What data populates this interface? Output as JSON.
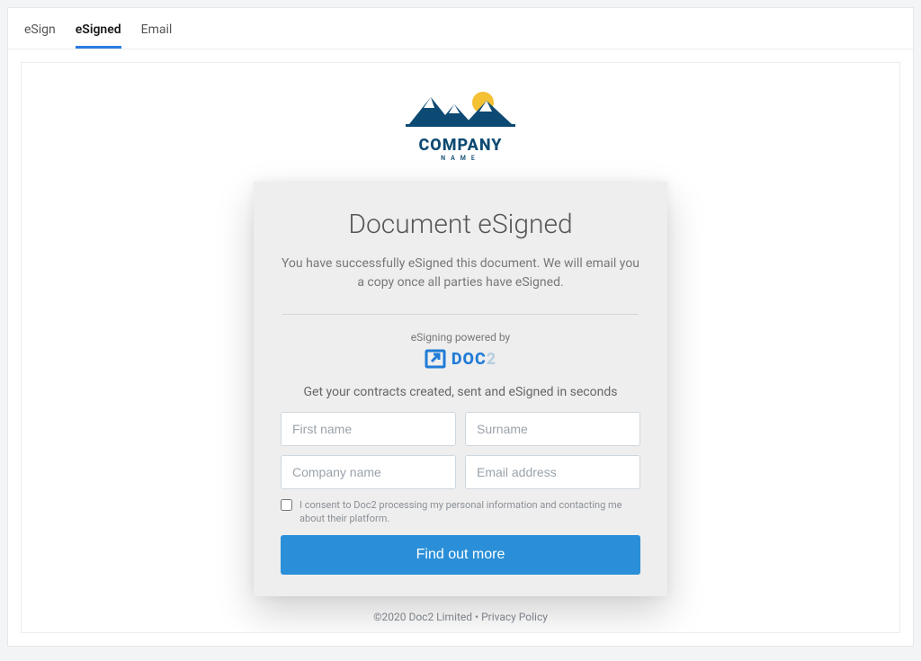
{
  "tabs": [
    {
      "label": "eSign",
      "active": false
    },
    {
      "label": "eSigned",
      "active": true
    },
    {
      "label": "Email",
      "active": false
    }
  ],
  "company_logo": {
    "name": "COMPANY",
    "subline": "NAME"
  },
  "card": {
    "title": "Document eSigned",
    "body": "You have successfully eSigned this document. We will email you a copy once all parties have eSigned.",
    "powered_by_label": "eSigning powered by",
    "provider_brand_part1": "DOC",
    "provider_brand_part2": "2",
    "cta_line": "Get your contracts created, sent and eSigned in seconds",
    "fields": {
      "first_name_placeholder": "First name",
      "surname_placeholder": "Surname",
      "company_placeholder": "Company name",
      "email_placeholder": "Email address"
    },
    "consent_text": "I consent to Doc2 processing my personal information and contacting me about their platform.",
    "submit_label": "Find out more"
  },
  "footer": {
    "copyright": "©2020 Doc2 Limited",
    "separator": " • ",
    "privacy_label": "Privacy Policy"
  }
}
